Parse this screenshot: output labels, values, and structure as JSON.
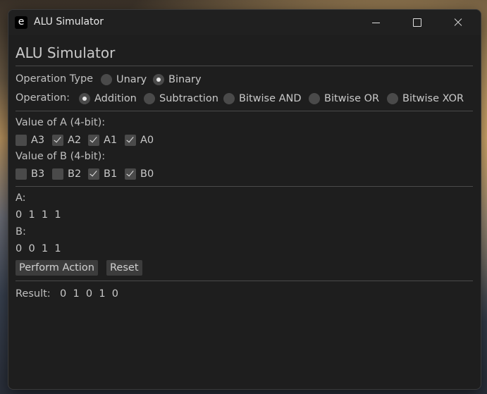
{
  "window": {
    "app_icon": "e",
    "title": "ALU Simulator"
  },
  "heading": "ALU Simulator",
  "operation_type": {
    "label": "Operation Type",
    "options": [
      {
        "label": "Unary",
        "selected": false
      },
      {
        "label": "Binary",
        "selected": true
      }
    ]
  },
  "operation": {
    "label": "Operation:",
    "options": [
      {
        "label": "Addition",
        "selected": true
      },
      {
        "label": "Subtraction",
        "selected": false
      },
      {
        "label": "Bitwise AND",
        "selected": false
      },
      {
        "label": "Bitwise OR",
        "selected": false
      },
      {
        "label": "Bitwise XOR",
        "selected": false
      }
    ]
  },
  "value_a": {
    "label": "Value of A (4-bit):",
    "bits": [
      {
        "label": "A3",
        "checked": false
      },
      {
        "label": "A2",
        "checked": true
      },
      {
        "label": "A1",
        "checked": true
      },
      {
        "label": "A0",
        "checked": true
      }
    ]
  },
  "value_b": {
    "label": "Value of B (4-bit):",
    "bits": [
      {
        "label": "B3",
        "checked": false
      },
      {
        "label": "B2",
        "checked": false
      },
      {
        "label": "B1",
        "checked": true
      },
      {
        "label": "B0",
        "checked": true
      }
    ]
  },
  "display": {
    "a_label": "A:",
    "a_value": "0  1  1  1",
    "b_label": "B:",
    "b_value": "0  0  1  1"
  },
  "buttons": {
    "perform": "Perform Action",
    "reset": "Reset"
  },
  "result": {
    "label": "Result:",
    "value": "0  1  0  1  0"
  }
}
